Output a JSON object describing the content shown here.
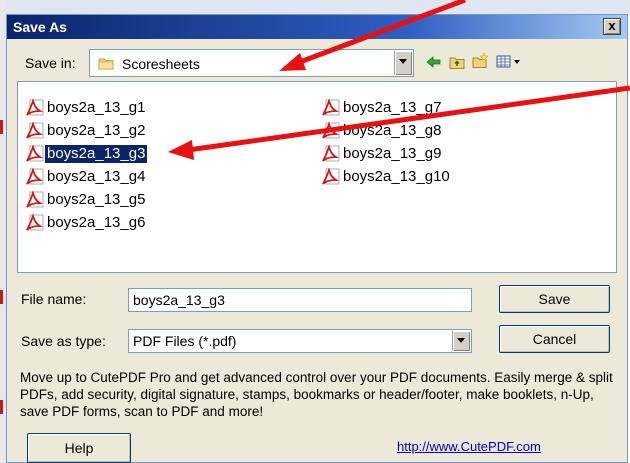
{
  "window": {
    "title": "Save As",
    "close_label": "x"
  },
  "save_in": {
    "label": "Save in:",
    "value": "Scoresheets"
  },
  "toolbar": {
    "icons": [
      "back-arrow-icon",
      "up-folder-icon",
      "new-folder-icon",
      "view-menu-icon"
    ]
  },
  "files": [
    "boys2a_13_g1",
    "boys2a_13_g2",
    "boys2a_13_g3",
    "boys2a_13_g4",
    "boys2a_13_g5",
    "boys2a_13_g6",
    "boys2a_13_g7",
    "boys2a_13_g8",
    "boys2a_13_g9",
    "boys2a_13_g10"
  ],
  "selected_file_index": 2,
  "file_name": {
    "label": "File name:",
    "value": "boys2a_13_g3"
  },
  "save_type": {
    "label": "Save as type:",
    "value": "PDF Files (*.pdf)"
  },
  "buttons": {
    "save": "Save",
    "cancel": "Cancel",
    "help": "Help"
  },
  "promo_text": "Move up to CutePDF Pro and get advanced control over your PDF documents. Easily merge & split PDFs, add security, digital signature, stamps, bookmarks or header/footer, make booklets, n-Up, save PDF forms, scan to PDF and more!",
  "link_text": "http://www.CutePDF.com",
  "colors": {
    "annotation_arrow": "#e81010",
    "selection": "#0a246a",
    "title_bar": "#0a246a"
  }
}
